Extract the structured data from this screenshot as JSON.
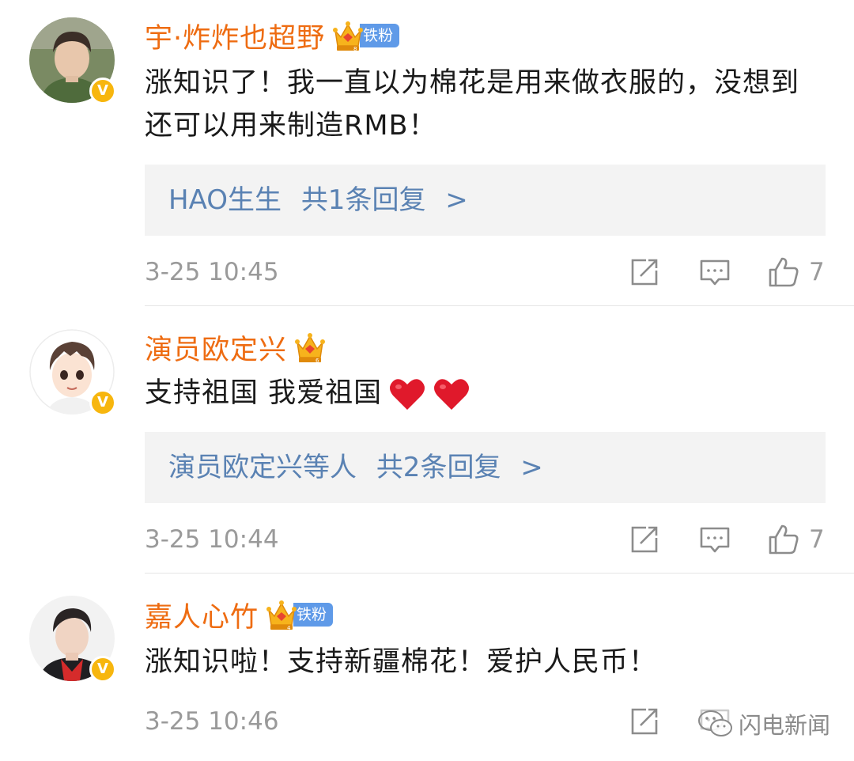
{
  "colors": {
    "username": "#ee6c12",
    "reply_link": "#5a82b3",
    "fan_badge": "#5f9ae8",
    "verified_badge": "#f7b60e",
    "meta_gray": "#9a9a9a",
    "reply_bg": "#f3f3f3"
  },
  "comments": [
    {
      "username": "宇·炸炸也超野",
      "crown_level": "8",
      "fan_badge": "铁粉",
      "text": "涨知识了！我一直以为棉花是用来做衣服的，没想到还可以用来制造RMB！",
      "replies": {
        "names": "HAO生生",
        "count": "共1条回复",
        "arrow": ">"
      },
      "timestamp": "3-25 10:45",
      "likes": "7",
      "icons": [
        "share-icon",
        "comment-icon",
        "like-icon"
      ]
    },
    {
      "username": "演员欧定兴",
      "crown_level": "6",
      "text": "支持祖国 我爱祖国",
      "emoji": [
        "heart-icon",
        "heart-icon"
      ],
      "replies": {
        "names": "演员欧定兴等人",
        "count": "共2条回复",
        "arrow": ">"
      },
      "timestamp": "3-25 10:44",
      "likes": "7",
      "icons": [
        "share-icon",
        "comment-icon",
        "like-icon"
      ]
    },
    {
      "username": "嘉人心竹",
      "crown_level": "4",
      "fan_badge": "铁粉",
      "text": "涨知识啦！支持新疆棉花！爱护人民币！",
      "timestamp": "3-25 10:46",
      "icons": [
        "share-icon",
        "comment-icon"
      ]
    }
  ],
  "verified_mark": "V",
  "watermark": {
    "text": "闪电新闻",
    "icon": "wechat-icon"
  }
}
